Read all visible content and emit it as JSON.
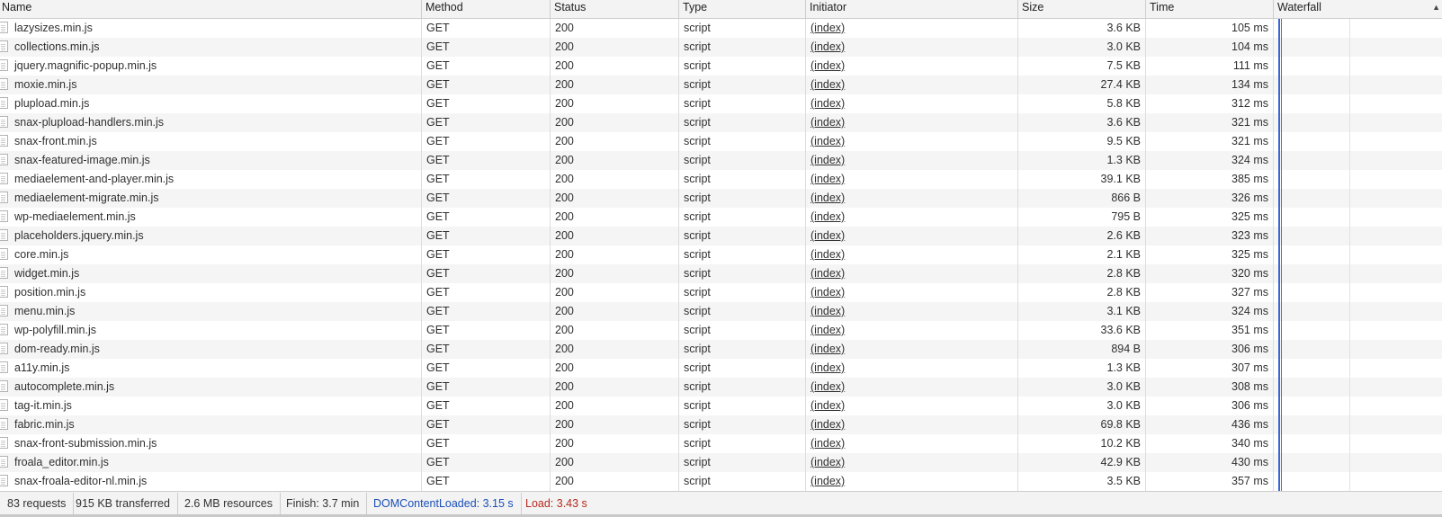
{
  "columns": {
    "name": "Name",
    "method": "Method",
    "status": "Status",
    "type": "Type",
    "initiator": "Initiator",
    "size": "Size",
    "time": "Time",
    "waterfall": "Waterfall"
  },
  "rows": [
    {
      "name": "lazysizes.min.js",
      "method": "GET",
      "status": "200",
      "type": "script",
      "initiator": "(index)",
      "size": "3.6 KB",
      "time": "105 ms"
    },
    {
      "name": "collections.min.js",
      "method": "GET",
      "status": "200",
      "type": "script",
      "initiator": "(index)",
      "size": "3.0 KB",
      "time": "104 ms"
    },
    {
      "name": "jquery.magnific-popup.min.js",
      "method": "GET",
      "status": "200",
      "type": "script",
      "initiator": "(index)",
      "size": "7.5 KB",
      "time": "111 ms"
    },
    {
      "name": "moxie.min.js",
      "method": "GET",
      "status": "200",
      "type": "script",
      "initiator": "(index)",
      "size": "27.4 KB",
      "time": "134 ms"
    },
    {
      "name": "plupload.min.js",
      "method": "GET",
      "status": "200",
      "type": "script",
      "initiator": "(index)",
      "size": "5.8 KB",
      "time": "312 ms"
    },
    {
      "name": "snax-plupload-handlers.min.js",
      "method": "GET",
      "status": "200",
      "type": "script",
      "initiator": "(index)",
      "size": "3.6 KB",
      "time": "321 ms"
    },
    {
      "name": "snax-front.min.js",
      "method": "GET",
      "status": "200",
      "type": "script",
      "initiator": "(index)",
      "size": "9.5 KB",
      "time": "321 ms"
    },
    {
      "name": "snax-featured-image.min.js",
      "method": "GET",
      "status": "200",
      "type": "script",
      "initiator": "(index)",
      "size": "1.3 KB",
      "time": "324 ms"
    },
    {
      "name": "mediaelement-and-player.min.js",
      "method": "GET",
      "status": "200",
      "type": "script",
      "initiator": "(index)",
      "size": "39.1 KB",
      "time": "385 ms"
    },
    {
      "name": "mediaelement-migrate.min.js",
      "method": "GET",
      "status": "200",
      "type": "script",
      "initiator": "(index)",
      "size": "866 B",
      "time": "326 ms"
    },
    {
      "name": "wp-mediaelement.min.js",
      "method": "GET",
      "status": "200",
      "type": "script",
      "initiator": "(index)",
      "size": "795 B",
      "time": "325 ms"
    },
    {
      "name": "placeholders.jquery.min.js",
      "method": "GET",
      "status": "200",
      "type": "script",
      "initiator": "(index)",
      "size": "2.6 KB",
      "time": "323 ms"
    },
    {
      "name": "core.min.js",
      "method": "GET",
      "status": "200",
      "type": "script",
      "initiator": "(index)",
      "size": "2.1 KB",
      "time": "325 ms"
    },
    {
      "name": "widget.min.js",
      "method": "GET",
      "status": "200",
      "type": "script",
      "initiator": "(index)",
      "size": "2.8 KB",
      "time": "320 ms"
    },
    {
      "name": "position.min.js",
      "method": "GET",
      "status": "200",
      "type": "script",
      "initiator": "(index)",
      "size": "2.8 KB",
      "time": "327 ms"
    },
    {
      "name": "menu.min.js",
      "method": "GET",
      "status": "200",
      "type": "script",
      "initiator": "(index)",
      "size": "3.1 KB",
      "time": "324 ms"
    },
    {
      "name": "wp-polyfill.min.js",
      "method": "GET",
      "status": "200",
      "type": "script",
      "initiator": "(index)",
      "size": "33.6 KB",
      "time": "351 ms"
    },
    {
      "name": "dom-ready.min.js",
      "method": "GET",
      "status": "200",
      "type": "script",
      "initiator": "(index)",
      "size": "894 B",
      "time": "306 ms"
    },
    {
      "name": "a11y.min.js",
      "method": "GET",
      "status": "200",
      "type": "script",
      "initiator": "(index)",
      "size": "1.3 KB",
      "time": "307 ms"
    },
    {
      "name": "autocomplete.min.js",
      "method": "GET",
      "status": "200",
      "type": "script",
      "initiator": "(index)",
      "size": "3.0 KB",
      "time": "308 ms"
    },
    {
      "name": "tag-it.min.js",
      "method": "GET",
      "status": "200",
      "type": "script",
      "initiator": "(index)",
      "size": "3.0 KB",
      "time": "306 ms"
    },
    {
      "name": "fabric.min.js",
      "method": "GET",
      "status": "200",
      "type": "script",
      "initiator": "(index)",
      "size": "69.8 KB",
      "time": "436 ms"
    },
    {
      "name": "snax-front-submission.min.js",
      "method": "GET",
      "status": "200",
      "type": "script",
      "initiator": "(index)",
      "size": "10.2 KB",
      "time": "340 ms"
    },
    {
      "name": "froala_editor.min.js",
      "method": "GET",
      "status": "200",
      "type": "script",
      "initiator": "(index)",
      "size": "42.9 KB",
      "time": "430 ms"
    },
    {
      "name": "snax-froala-editor-nl.min.js",
      "method": "GET",
      "status": "200",
      "type": "script",
      "initiator": "(index)",
      "size": "3.5 KB",
      "time": "357 ms"
    }
  ],
  "status_bar": {
    "requests": "83 requests",
    "transferred": "915 KB transferred",
    "resources": "2.6 MB resources",
    "finish": "Finish: 3.7 min",
    "dom_content_loaded": "DOMContentLoaded: 3.15 s",
    "load": "Load: 3.43 s"
  },
  "colors": {
    "dom_content_loaded": "#1a4fb8",
    "load": "#b4291f",
    "header_bg": "#f3f3f3",
    "row_alt_bg": "#f5f5f5"
  },
  "sort_indicator_icon": "sort-ascending-triangle-icon"
}
